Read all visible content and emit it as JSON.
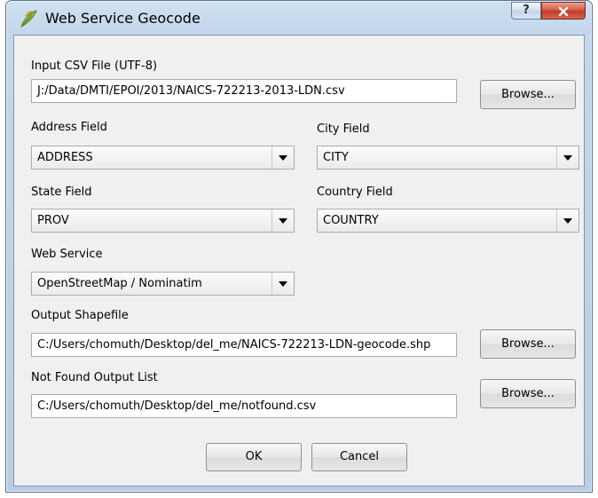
{
  "window": {
    "title": "Web Service Geocode",
    "help_label": "?",
    "close_label": "X"
  },
  "input_csv": {
    "label": "Input CSV File (UTF-8)",
    "value": "J:/Data/DMTI/EPOI/2013/NAICS-722213-2013-LDN.csv",
    "browse_label": "Browse..."
  },
  "address_field": {
    "label": "Address Field",
    "selected": "ADDRESS"
  },
  "city_field": {
    "label": "City Field",
    "selected": "CITY"
  },
  "state_field": {
    "label": "State Field",
    "selected": "PROV"
  },
  "country_field": {
    "label": "Country Field",
    "selected": "COUNTRY"
  },
  "web_service": {
    "label": "Web Service",
    "selected": "OpenStreetMap / Nominatim"
  },
  "output_shapefile": {
    "label": "Output Shapefile",
    "value": "C:/Users/chomuth/Desktop/del_me/NAICS-722213-LDN-geocode.shp",
    "browse_label": "Browse..."
  },
  "not_found": {
    "label": "Not Found Output List",
    "value": "C:/Users/chomuth/Desktop/del_me/notfound.csv",
    "browse_label": "Browse..."
  },
  "buttons": {
    "ok_label": "OK",
    "cancel_label": "Cancel"
  },
  "icons": {
    "app": "qgis-leaf-icon",
    "dropdown": "chevron-down-icon"
  }
}
